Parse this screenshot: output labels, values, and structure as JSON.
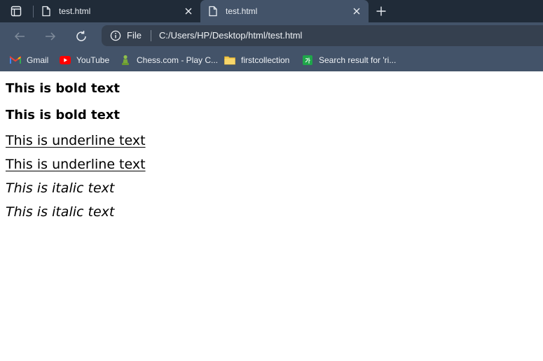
{
  "tabs": [
    {
      "title": "test.html",
      "active": false
    },
    {
      "title": "test.html",
      "active": true
    }
  ],
  "address": {
    "scheme": "File",
    "url": "C:/Users/HP/Desktop/html/test.html"
  },
  "bookmarks": [
    {
      "label": "Gmail",
      "icon": "gmail-icon"
    },
    {
      "label": "YouTube",
      "icon": "youtube-icon"
    },
    {
      "label": "Chess.com - Play C...",
      "icon": "chess-icon"
    },
    {
      "label": "firstcollection",
      "icon": "folder-icon"
    },
    {
      "label": "Search result for 'ri...",
      "icon": "search-result-icon"
    }
  ],
  "page": {
    "lines": [
      "This is bold text",
      "This is bold text",
      "This is underline text",
      "This is underline text",
      "This is italic text",
      "This is italic text"
    ]
  },
  "colors": {
    "tabstrip": "#202b38",
    "toolbar": "#435369",
    "address_bg": "#35404f",
    "text_light": "#eef1f5"
  }
}
